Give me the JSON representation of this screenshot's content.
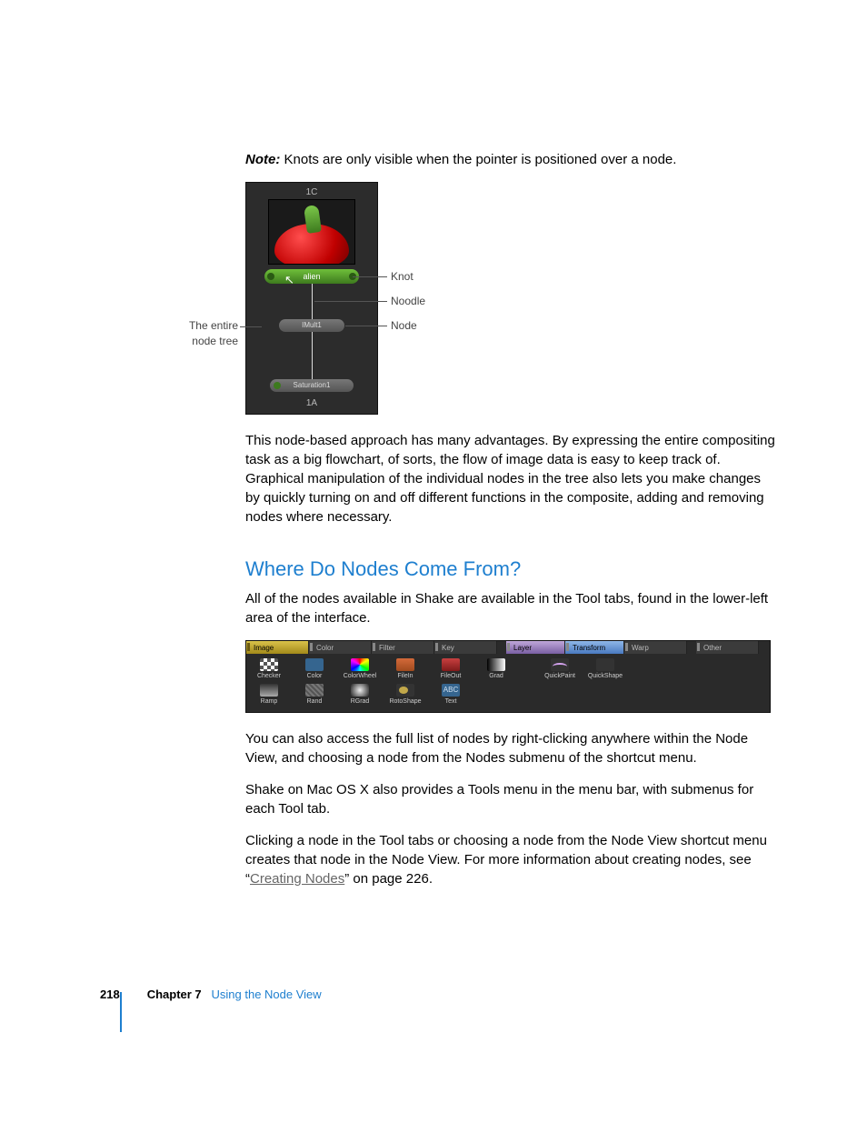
{
  "note_label": "Note:",
  "note_text": "Knots are only visible when the pointer is positioned over a node.",
  "fig1": {
    "side_left_l1": "The entire",
    "side_left_l2": "node tree",
    "label_knot": "Knot",
    "label_noodle": "Noodle",
    "label_node": "Node",
    "top": "1C",
    "alien": "alien",
    "mid": "IMult1",
    "sat": "Saturation1",
    "bottom": "1A"
  },
  "para1": "This node-based approach has many advantages. By expressing the entire compositing task as a big flowchart, of sorts, the flow of image data is easy to keep track of. Graphical manipulation of the individual nodes in the tree also lets you make changes by quickly turning on and off different functions in the composite, adding and removing nodes where necessary.",
  "heading": "Where Do Nodes Come From?",
  "para2": "All of the nodes available in Shake are available in the Tool tabs, found in the lower-left area of the interface.",
  "tabs": [
    "Image",
    "Color",
    "Filter",
    "Key",
    "Layer",
    "Transform",
    "Warp",
    "Other"
  ],
  "tools_row1": [
    "Checker",
    "Color",
    "ColorWheel",
    "FileIn",
    "FileOut",
    "Grad",
    "QuickPaint",
    "QuickShape"
  ],
  "tools_row2": [
    "Ramp",
    "Rand",
    "RGrad",
    "RotoShape",
    "Text"
  ],
  "text_icon": "ABC",
  "para3": "You can also access the full list of nodes by right-clicking anywhere within the Node View, and choosing a node from the Nodes submenu of the shortcut menu.",
  "para4": "Shake on Mac OS X also provides a Tools menu in the menu bar, with submenus for each Tool tab.",
  "para5_a": "Clicking a node in the Tool tabs or choosing a node from the Node View shortcut menu creates that node in the Node View. For more information about creating nodes, see “",
  "para5_link": "Creating Nodes",
  "para5_b": "” on page 226.",
  "footer": {
    "page": "218",
    "chapter": "Chapter 7",
    "title": "Using the Node View"
  }
}
